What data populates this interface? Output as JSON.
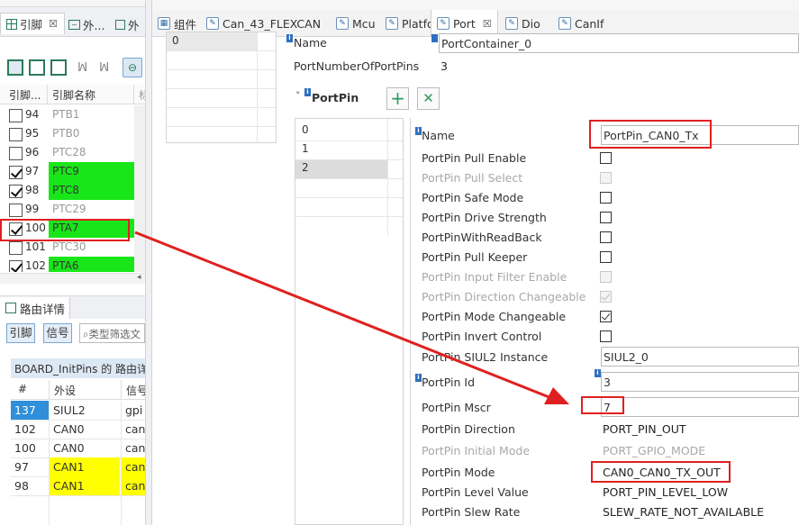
{
  "left_tabs": [
    {
      "label": "引脚",
      "icon": "table-icon"
    },
    {
      "label": "外...",
      "icon": "chart-icon"
    },
    {
      "label": "外",
      "icon": "peripheral-icon"
    }
  ],
  "editor_tabs": [
    {
      "label": "组件",
      "icon": "component-icon"
    },
    {
      "label": "Can_43_FLEXCAN",
      "icon": "doc-icon"
    },
    {
      "label": "Mcu",
      "icon": "doc-icon"
    },
    {
      "label": "Platform",
      "icon": "doc-icon"
    },
    {
      "label": "Port",
      "icon": "doc-icon",
      "active": true
    },
    {
      "label": "Dio",
      "icon": "doc-icon"
    },
    {
      "label": "CanIf",
      "icon": "doc-icon"
    }
  ],
  "pins_table": {
    "headers": [
      "引脚...",
      "引脚名称",
      "标"
    ],
    "rows": [
      {
        "num": "94",
        "name": "PTB1",
        "checked": false,
        "highlight": ""
      },
      {
        "num": "95",
        "name": "PTB0",
        "checked": false,
        "highlight": ""
      },
      {
        "num": "96",
        "name": "PTC28",
        "checked": false,
        "highlight": ""
      },
      {
        "num": "97",
        "name": "PTC9",
        "checked": true,
        "highlight": "green"
      },
      {
        "num": "98",
        "name": "PTC8",
        "checked": true,
        "highlight": "green"
      },
      {
        "num": "99",
        "name": "PTC29",
        "checked": false,
        "highlight": ""
      },
      {
        "num": "100",
        "name": "PTA7",
        "checked": true,
        "highlight": "green"
      },
      {
        "num": "101",
        "name": "PTC30",
        "checked": false,
        "highlight": ""
      },
      {
        "num": "102",
        "name": "PTA6",
        "checked": true,
        "highlight": "green"
      }
    ]
  },
  "routing": {
    "tab_label": "路由详情",
    "btn_pins": "引脚",
    "btn_signals": "信号",
    "filter_placeholder": "类型筛选文",
    "group_title": "BOARD_InitPins 的 路由详",
    "headers": [
      "#",
      "外设",
      "信号"
    ],
    "rows": [
      {
        "num": "137",
        "periph": "SIUL2",
        "sig": "gpi",
        "num_hl": "blue",
        "periph_hl": ""
      },
      {
        "num": "102",
        "periph": "CAN0",
        "sig": "can",
        "num_hl": "",
        "periph_hl": ""
      },
      {
        "num": "100",
        "periph": "CAN0",
        "sig": "can",
        "num_hl": "",
        "periph_hl": ""
      },
      {
        "num": "97",
        "periph": "CAN1",
        "sig": "can",
        "num_hl": "",
        "periph_hl": "yellow"
      },
      {
        "num": "98",
        "periph": "CAN1",
        "sig": "can",
        "num_hl": "",
        "periph_hl": "yellow"
      }
    ]
  },
  "container": {
    "list_item": "0",
    "name_label": "Name",
    "name_value": "PortContainer_0",
    "count_label": "PortNumberOfPortPins",
    "count_value": "3"
  },
  "portpin": {
    "section_title": "PortPin",
    "add_label": "+",
    "remove_label": "✕",
    "items": [
      "0",
      "1",
      "2"
    ],
    "selected": "2"
  },
  "props": {
    "name_label": "Name",
    "name_value": "PortPin_CAN0_Tx",
    "checkboxes": [
      {
        "label": "PortPin Pull Enable",
        "checked": false,
        "disabled": false
      },
      {
        "label": "PortPin Pull Select",
        "checked": false,
        "disabled": true
      },
      {
        "label": "PortPin Safe Mode",
        "checked": false,
        "disabled": false
      },
      {
        "label": "PortPin Drive Strength",
        "checked": false,
        "disabled": false
      },
      {
        "label": "PortPinWithReadBack",
        "checked": false,
        "disabled": false
      },
      {
        "label": "PortPin Pull Keeper",
        "checked": false,
        "disabled": false
      },
      {
        "label": "PortPin Input Filter Enable",
        "checked": false,
        "disabled": true
      },
      {
        "label": "PortPin Direction Changeable",
        "checked": true,
        "disabled": true
      },
      {
        "label": "PortPin Mode Changeable",
        "checked": true,
        "disabled": false
      },
      {
        "label": "PortPin Invert Control",
        "checked": false,
        "disabled": false
      }
    ],
    "siul2_label": "PortPin SIUL2 Instance",
    "siul2_value": "SIUL2_0",
    "id_label": "PortPin Id",
    "id_value": "3",
    "mscr_label": "PortPin Mscr",
    "mscr_value": "7",
    "direction_label": "PortPin Direction",
    "direction_value": "PORT_PIN_OUT",
    "initmode_label": "PortPin Initial Mode",
    "initmode_value": "PORT_GPIO_MODE",
    "mode_label": "PortPin Mode",
    "mode_value": "CAN0_CAN0_TX_OUT",
    "level_label": "PortPin Level Value",
    "level_value": "PORT_PIN_LEVEL_LOW",
    "slew_label": "PortPin Slew Rate",
    "slew_value": "SLEW_RATE_NOT_AVAILABLE"
  },
  "colors": {
    "highlight_green": "#19e619",
    "highlight_yellow": "#ffff00",
    "annotation_red": "#e02020",
    "selection_blue": "#2f6fc0"
  }
}
